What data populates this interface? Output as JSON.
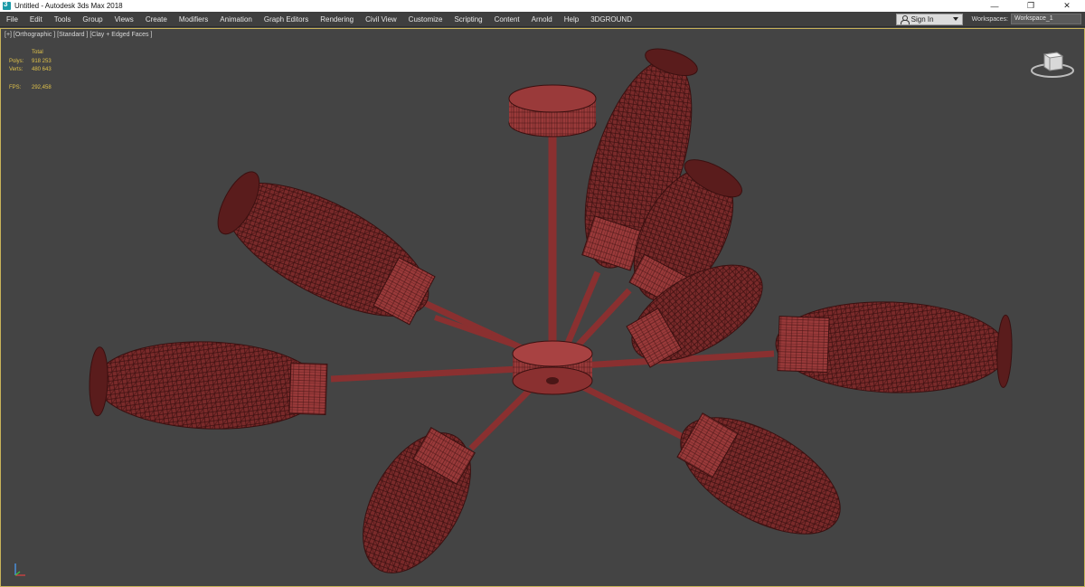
{
  "window": {
    "title": "Untitled - Autodesk 3ds Max 2018",
    "controls": {
      "minimize": "—",
      "restore": "❐",
      "close": "✕"
    }
  },
  "menubar": {
    "items": [
      "File",
      "Edit",
      "Tools",
      "Group",
      "Views",
      "Create",
      "Modifiers",
      "Animation",
      "Graph Editors",
      "Rendering",
      "Civil View",
      "Customize",
      "Scripting",
      "Content",
      "Arnold",
      "Help",
      "3DGROUND"
    ],
    "sign_in": "Sign In",
    "workspaces_label": "Workspaces:",
    "workspace_value": "Workspace_1"
  },
  "viewport": {
    "label": "[+] [Orthographic ] [Standard ] [Clay + Edged Faces ]",
    "stats": {
      "header": "Total",
      "polys_label": "Polys:",
      "polys_value": "918 253",
      "verts_label": "Verts:",
      "verts_value": "480 643",
      "fps_label": "FPS:",
      "fps_value": "292,458"
    }
  },
  "colors": {
    "mesh_fill": "#7a2a2a",
    "mesh_light": "#a84242",
    "mesh_edge": "#3a1010",
    "viewport_bg": "#444444",
    "stats_text": "#e0c24a",
    "active_border": "#c9b35a"
  },
  "icons": {
    "app": "3dsmax-icon",
    "sign_in": "user-icon",
    "viewcube": "viewcube-icon",
    "axis": "axis-tripod-icon"
  }
}
